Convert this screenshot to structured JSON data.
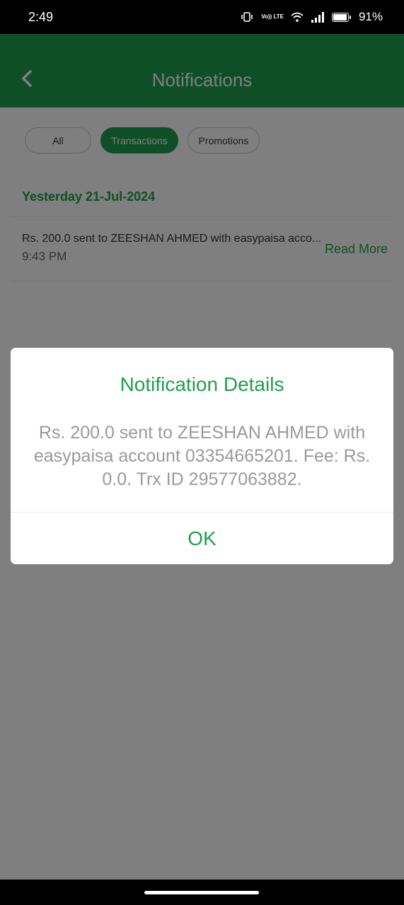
{
  "status_bar": {
    "time": "2:49",
    "network_label": "Vo)) LTE",
    "battery": "91%"
  },
  "header": {
    "title": "Notifications"
  },
  "filters": [
    {
      "label": "All",
      "active": false
    },
    {
      "label": "Transactions",
      "active": true
    },
    {
      "label": "Promotions",
      "active": false
    }
  ],
  "section": {
    "date_label": "Yesterday 21-Jul-2024"
  },
  "notification": {
    "message": "Rs. 200.0 sent to ZEESHAN AHMED with easypaisa acco...",
    "time": "9:43 PM",
    "read_more": "Read More"
  },
  "dialog": {
    "title": "Notification Details",
    "message": "Rs. 200.0 sent to ZEESHAN AHMED with easypaisa account 03354665201. Fee: Rs. 0.0. Trx ID 29577063882.",
    "ok_label": "OK"
  },
  "colors": {
    "brand_green": "#1f9f4f",
    "dialog_text": "#9a9a9a",
    "overlay": "rgba(0,0,0,0.5)"
  },
  "icons": {
    "back": "chevron-left-icon",
    "vibrate": "vibrate-icon",
    "wifi": "wifi-icon",
    "signal": "signal-icon",
    "battery": "battery-icon"
  }
}
